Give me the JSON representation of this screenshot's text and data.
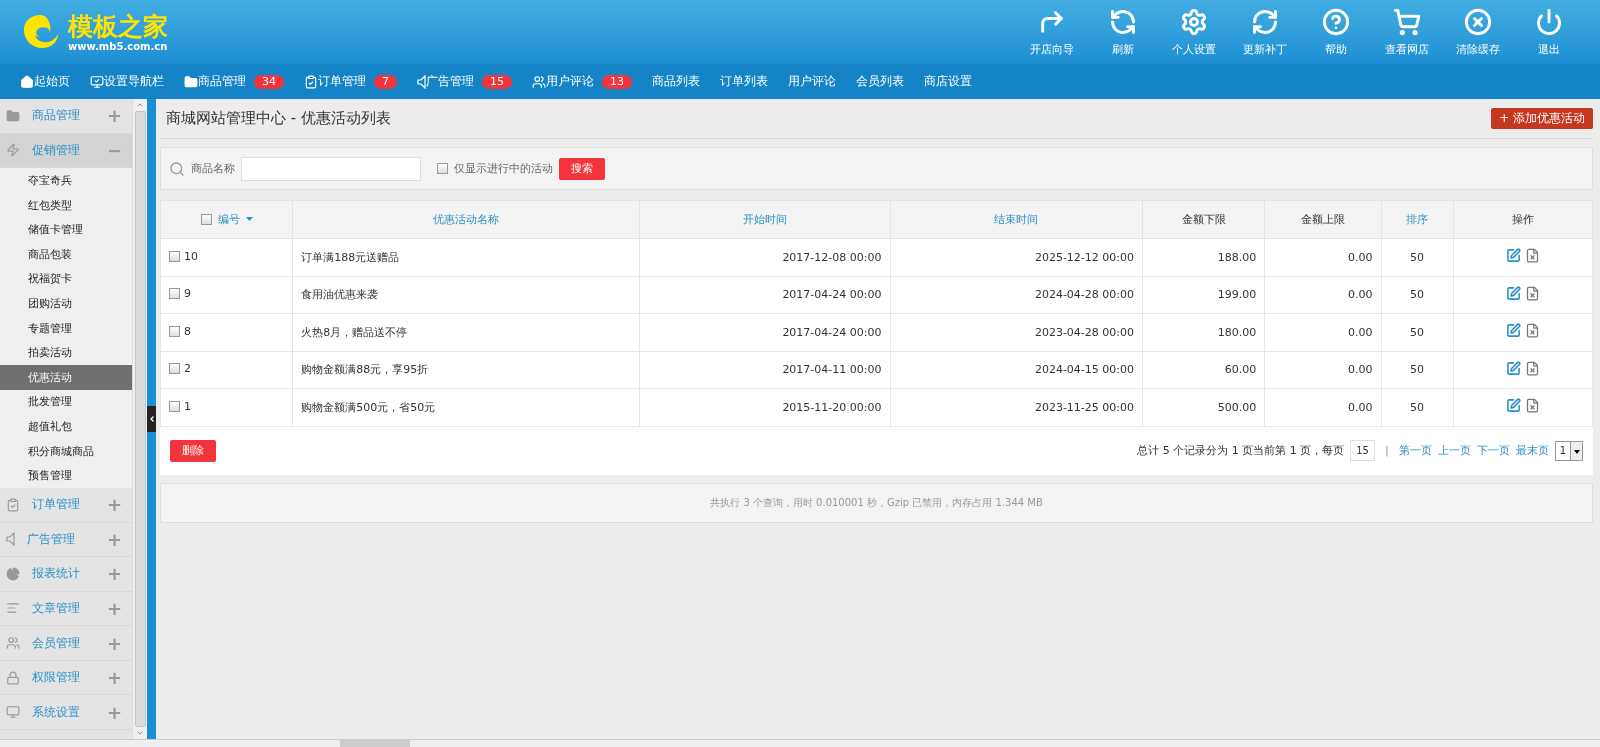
{
  "logo": {
    "name": "模板之家",
    "url": "www.mb5.com.cn"
  },
  "toolbar": [
    {
      "label": "开店向导"
    },
    {
      "label": "刷新"
    },
    {
      "label": "个人设置"
    },
    {
      "label": "更新补丁"
    },
    {
      "label": "帮助"
    },
    {
      "label": "查看网店"
    },
    {
      "label": "清除缓存"
    },
    {
      "label": "退出"
    }
  ],
  "nav": [
    {
      "label": "起始页",
      "kind": "icon"
    },
    {
      "label": "设置导航栏",
      "kind": "icon"
    },
    {
      "label": "商品管理",
      "kind": "icon",
      "badge": "34"
    },
    {
      "label": "订单管理",
      "kind": "icon",
      "badge": "7"
    },
    {
      "label": "广告管理",
      "kind": "icon",
      "badge": "15"
    },
    {
      "label": "用户评论",
      "kind": "icon",
      "badge": "13"
    },
    {
      "label": "商品列表",
      "kind": "text"
    },
    {
      "label": "订单列表",
      "kind": "text"
    },
    {
      "label": "用户评论",
      "kind": "text"
    },
    {
      "label": "会员列表",
      "kind": "text"
    },
    {
      "label": "商店设置",
      "kind": "text"
    }
  ],
  "sidebar": {
    "groups": [
      {
        "label": "商品管理",
        "expanded": false,
        "sign": "+"
      },
      {
        "label": "促销管理",
        "expanded": true,
        "sign": "−",
        "children": [
          {
            "label": "夺宝奇兵",
            "selected": false
          },
          {
            "label": "红包类型",
            "selected": false
          },
          {
            "label": "储值卡管理",
            "selected": false
          },
          {
            "label": "商品包装",
            "selected": false
          },
          {
            "label": "祝福贺卡",
            "selected": false
          },
          {
            "label": "团购活动",
            "selected": false
          },
          {
            "label": "专题管理",
            "selected": false
          },
          {
            "label": "拍卖活动",
            "selected": false
          },
          {
            "label": "优惠活动",
            "selected": true
          },
          {
            "label": "批发管理",
            "selected": false
          },
          {
            "label": "超值礼包",
            "selected": false
          },
          {
            "label": "积分商城商品",
            "selected": false
          },
          {
            "label": "预售管理",
            "selected": false
          }
        ]
      },
      {
        "label": "订单管理",
        "expanded": false,
        "sign": "+"
      },
      {
        "label": "广告管理",
        "expanded": false,
        "sign": "+"
      },
      {
        "label": "报表统计",
        "expanded": false,
        "sign": "+"
      },
      {
        "label": "文章管理",
        "expanded": false,
        "sign": "+"
      },
      {
        "label": "会员管理",
        "expanded": false,
        "sign": "+"
      },
      {
        "label": "权限管理",
        "expanded": false,
        "sign": "+"
      },
      {
        "label": "系统设置",
        "expanded": false,
        "sign": "+"
      }
    ]
  },
  "page": {
    "title": "商城网站管理中心 - 优惠活动列表",
    "add_button": "+ 添加优惠活动"
  },
  "search": {
    "label": "商品名称",
    "only_active": {
      "label": "仅显示进行中的活动",
      "checked": false
    },
    "button": "搜索"
  },
  "table": {
    "select_all_checked": false,
    "columns": [
      {
        "label": "编号",
        "sortable": true
      },
      {
        "label": "优惠活动名称",
        "sortable": true
      },
      {
        "label": "开始时间",
        "sortable": true
      },
      {
        "label": "结束时间",
        "sortable": true
      },
      {
        "label": "金额下限",
        "sortable": false
      },
      {
        "label": "金额上限",
        "sortable": false
      },
      {
        "label": "排序",
        "sortable": true
      },
      {
        "label": "操作",
        "sortable": false
      }
    ],
    "rows": [
      {
        "checked": false,
        "id": "10",
        "name": "订单满188元送赠品",
        "start": "2017-12-08 00:00",
        "end": "2025-12-12 00:00",
        "min": "188.00",
        "max": "0.00",
        "sort": "50"
      },
      {
        "checked": false,
        "id": "9",
        "name": "食用油优惠来袭",
        "start": "2017-04-24 00:00",
        "end": "2024-04-28 00:00",
        "min": "199.00",
        "max": "0.00",
        "sort": "50"
      },
      {
        "checked": false,
        "id": "8",
        "name": "火热8月，赠品送不停",
        "start": "2017-04-24 00:00",
        "end": "2023-04-28 00:00",
        "min": "180.00",
        "max": "0.00",
        "sort": "50"
      },
      {
        "checked": false,
        "id": "2",
        "name": "购物金额满88元，享95折",
        "start": "2017-04-11 00:00",
        "end": "2024-04-15 00:00",
        "min": "60.00",
        "max": "0.00",
        "sort": "50"
      },
      {
        "checked": false,
        "id": "1",
        "name": "购物金额满500元，省50元",
        "start": "2015-11-20 00:00",
        "end": "2023-11-25 00:00",
        "min": "500.00",
        "max": "0.00",
        "sort": "50"
      }
    ]
  },
  "footer": {
    "delete_button": "删除",
    "summary": "总计 5 个记录分为 1 页当前第 1 页，每页",
    "page_size": "15",
    "separator": "|",
    "links": [
      "第一页",
      "上一页",
      "下一页",
      "最末页"
    ],
    "page": "1"
  },
  "stats": "共执行 3 个查询，用时 0.010001 秒，Gzip 已禁用，内存占用 1.344 MB"
}
